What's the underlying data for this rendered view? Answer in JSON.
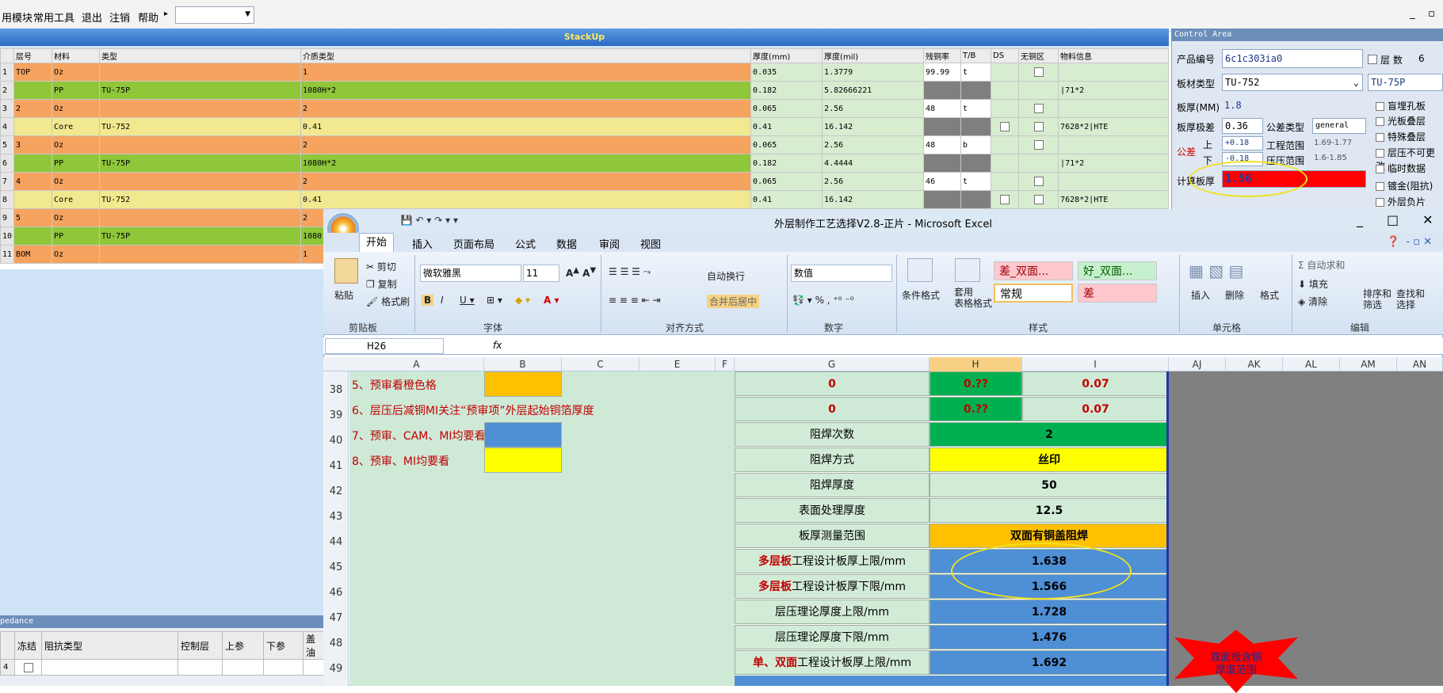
{
  "menu": {
    "items": [
      "用模块",
      "常用工具",
      "退出",
      "注销",
      "帮助"
    ],
    "help_arrow": "▸"
  },
  "stackup": {
    "title": "StackUp",
    "headers": [
      "层号",
      "材料",
      "类型",
      "介质类型",
      "厚度(mm)",
      "厚度(mil)",
      "残铜率",
      "T/B",
      "DS",
      "无铜区",
      "物料信息"
    ],
    "rows": [
      {
        "no": "1",
        "layer": "TOP",
        "material": "Oz",
        "type": "",
        "dielectric": "1",
        "mm": "0.035",
        "mil": "1.3779",
        "copper": "99.99",
        "tb": "t",
        "info": "",
        "color": "or"
      },
      {
        "no": "2",
        "layer": "",
        "material": "PP",
        "type": "TU-75P",
        "dielectric": "1080H*2",
        "mm": "0.182",
        "mil": "5.82666221",
        "copper": "",
        "tb": "",
        "info": "|71*2",
        "color": "gr"
      },
      {
        "no": "3",
        "layer": "2",
        "material": "Oz",
        "type": "",
        "dielectric": "2",
        "mm": "0.065",
        "mil": "2.56",
        "copper": "48",
        "tb": "t",
        "info": "",
        "color": "or"
      },
      {
        "no": "4",
        "layer": "",
        "material": "Core",
        "type": "TU-752",
        "dielectric": "0.41",
        "mm": "0.41",
        "mil": "16.142",
        "copper": "",
        "tb": "",
        "info": "7628*2|HTE",
        "color": "ye"
      },
      {
        "no": "5",
        "layer": "3",
        "material": "Oz",
        "type": "",
        "dielectric": "2",
        "mm": "0.065",
        "mil": "2.56",
        "copper": "48",
        "tb": "b",
        "info": "",
        "color": "or"
      },
      {
        "no": "6",
        "layer": "",
        "material": "PP",
        "type": "TU-75P",
        "dielectric": "1080H*2",
        "mm": "0.182",
        "mil": "4.4444",
        "copper": "",
        "tb": "",
        "info": "|71*2",
        "color": "gr"
      },
      {
        "no": "7",
        "layer": "4",
        "material": "Oz",
        "type": "",
        "dielectric": "2",
        "mm": "0.065",
        "mil": "2.56",
        "copper": "46",
        "tb": "t",
        "info": "",
        "color": "or"
      },
      {
        "no": "8",
        "layer": "",
        "material": "Core",
        "type": "TU-752",
        "dielectric": "0.41",
        "mm": "0.41",
        "mil": "16.142",
        "copper": "",
        "tb": "",
        "info": "7628*2|HTE",
        "color": "ye"
      },
      {
        "no": "9",
        "layer": "5",
        "material": "Oz",
        "type": "",
        "dielectric": "2",
        "mm": "",
        "mil": "",
        "copper": "",
        "tb": "",
        "info": "",
        "color": "or"
      },
      {
        "no": "10",
        "layer": "",
        "material": "PP",
        "type": "TU-75P",
        "dielectric": "1080",
        "mm": "",
        "mil": "",
        "copper": "",
        "tb": "",
        "info": "",
        "color": "gr"
      },
      {
        "no": "11",
        "layer": "BOM",
        "material": "Oz",
        "type": "",
        "dielectric": "1",
        "mm": "",
        "mil": "",
        "copper": "",
        "tb": "",
        "info": "",
        "color": "or"
      }
    ]
  },
  "control": {
    "title": "Control Area",
    "product_label": "产品编号",
    "product_value": "6c1c303ia0",
    "layers_label": "层 数",
    "layers_value": "6",
    "board_type_label": "板材类型",
    "board_type_value": "TU-752",
    "board_type_value2": "TU-75P",
    "thick_label": "板厚(MM)",
    "thick_value": "1.8",
    "tol_label": "板厚极差",
    "tol_value": "0.36",
    "tol_type_label": "公差类型",
    "tol_type_value": "general",
    "gongcha_label": "公差",
    "up_label": "上",
    "up_value": "+0.18",
    "down_label": "下",
    "down_value": "-0.18",
    "eng_range_label": "工程范围",
    "eng_range_value": "1.69-1.77",
    "press_range_label": "压压范围",
    "press_range_value": "1.6-1.85",
    "calc_label": "计算板厚",
    "calc_value": "1.56",
    "options": [
      "盲埋孔板",
      "光板叠层",
      "特殊叠层",
      "层压不可更改",
      "临时数据",
      "镀金(阻抗)",
      "外层负片"
    ]
  },
  "impedance": {
    "title": "pedance",
    "headers": [
      "冻结",
      "阻抗类型",
      "控制层",
      "上参",
      "下参",
      "盖油"
    ],
    "row_no": "4"
  },
  "excel": {
    "title": "外层制作工艺选择V2.8-正片 - Microsoft Excel",
    "tabs": [
      "开始",
      "插入",
      "页面布局",
      "公式",
      "数据",
      "审阅",
      "视图"
    ],
    "ribbon": {
      "paste": "粘贴",
      "cut": "剪切",
      "copy": "复制",
      "format_painter": "格式刷",
      "clipboard": "剪贴板",
      "font_name": "微软雅黑",
      "font_size": "11",
      "font_group": "字体",
      "wrap": "自动换行",
      "merge": "合并后居中",
      "align_group": "对齐方式",
      "number_format": "数值",
      "number_group": "数字",
      "cond_format": "条件格式",
      "table_format": "套用\n表格格式",
      "style_bad_dual": "差_双面...",
      "style_good_dual": "好_双面...",
      "style_normal": "常规",
      "style_bad": "差",
      "style_group": "样式",
      "insert": "插入",
      "delete": "删除",
      "format": "格式",
      "cells_group": "单元格",
      "autosum": "Σ 自动求和",
      "fill": "填充",
      "clear": "清除",
      "sort": "排序和\n筛选",
      "find": "查找和\n选择",
      "edit_group": "编辑"
    },
    "namebox": "H26",
    "fx": "fx",
    "columns": [
      "A",
      "B",
      "C",
      "E",
      "F",
      "G",
      "H",
      "I",
      "AJ",
      "AK",
      "AL",
      "AM",
      "AN"
    ],
    "rows": [
      "38",
      "39",
      "40",
      "41",
      "42",
      "43",
      "44",
      "45",
      "46",
      "47",
      "48",
      "49"
    ],
    "notes": [
      "5、预审看橙色格",
      "6、层压后减铜MI关注“预审项”外层起始铜箔厚度",
      "7、预审、CAM、MI均要看",
      "8、预审、MI均要看"
    ],
    "table": [
      {
        "label": "0",
        "h": "0.??",
        "i": "0.07"
      },
      {
        "label": "0",
        "h": "0.??",
        "i": "0.07"
      },
      {
        "label": "阻焊次数",
        "hi": "2"
      },
      {
        "label": "阻焊方式",
        "hi": "丝印"
      },
      {
        "label": "阻焊厚度",
        "hi": "50"
      },
      {
        "label": "表面处理厚度",
        "hi": "12.5"
      },
      {
        "label": "板厚测量范围",
        "hi": "双面有铜盖阻焊"
      },
      {
        "label_red": "多层板",
        "label_rest": "工程设计板厚上限/mm",
        "hi": "1.638"
      },
      {
        "label_red": "多层板",
        "label_rest": "工程设计板厚下限/mm",
        "hi": "1.566"
      },
      {
        "label": "层压理论厚度上限/mm",
        "hi": "1.728"
      },
      {
        "label": "层压理论厚度下限/mm",
        "hi": "1.476"
      },
      {
        "label_red": "单、双面",
        "label_rest": "工程设计板厚上限/mm",
        "hi": "1.692"
      }
    ],
    "star_text": "双面板含铜\n厚度范围"
  },
  "colors": {
    "orange": "#f6a35f",
    "green": "#8fc63a",
    "yellow": "#f1e88f",
    "excel_green": "#00b050",
    "excel_yellow": "#ffff00",
    "excel_orange": "#ffc000",
    "excel_blue": "#4f8fd6"
  }
}
